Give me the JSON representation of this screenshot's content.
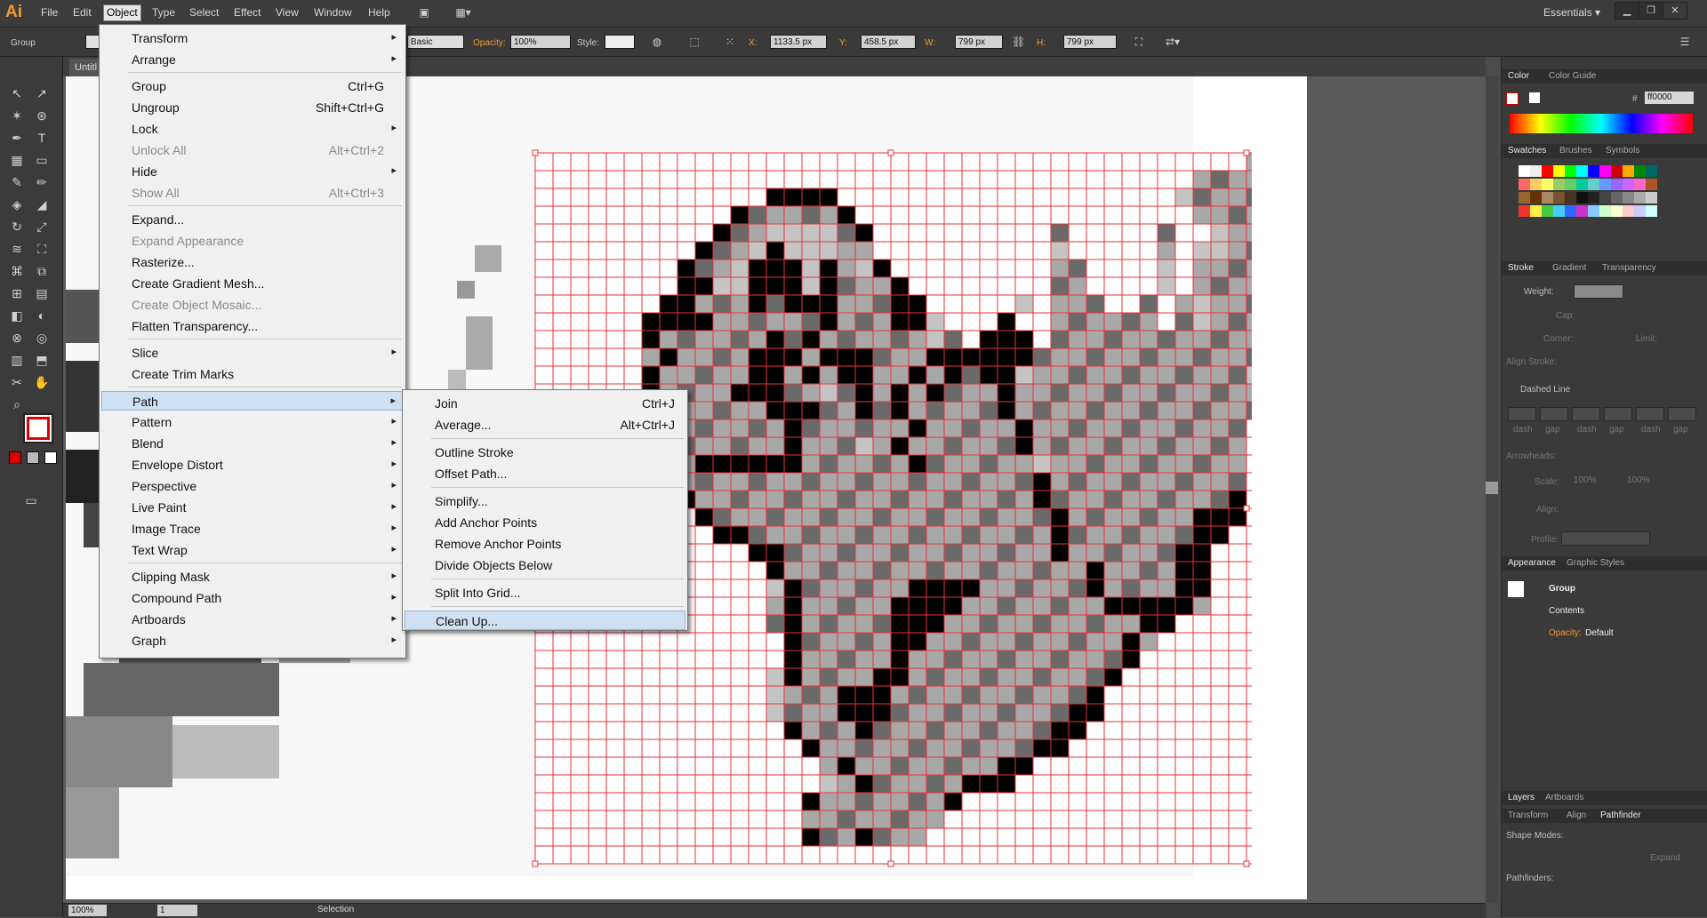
{
  "app": {
    "logo": "Ai"
  },
  "menubar": {
    "items": [
      "File",
      "Edit",
      "Object",
      "Type",
      "Select",
      "Effect",
      "View",
      "Window",
      "Help"
    ],
    "active": "Object",
    "workspace": "Essentials",
    "workspace_arrow": "▾"
  },
  "controlbar": {
    "selection": "Group",
    "stroke_style": "Basic",
    "opacity_label": "Opacity:",
    "opacity_value": "100%",
    "style_label": "Style:",
    "x_label": "X:",
    "x_value": "1133.5 px",
    "y_label": "Y:",
    "y_value": "458.5 px",
    "w_label": "W:",
    "w_value": "799 px",
    "h_label": "H:",
    "h_value": "799 px"
  },
  "document": {
    "tab_title": "Untitl"
  },
  "object_menu": {
    "items": [
      {
        "label": "Transform",
        "shortcut": "",
        "submenu": true,
        "disabled": false
      },
      {
        "label": "Arrange",
        "shortcut": "",
        "submenu": true,
        "disabled": false
      },
      {
        "sep": true
      },
      {
        "label": "Group",
        "shortcut": "Ctrl+G",
        "submenu": false,
        "disabled": false
      },
      {
        "label": "Ungroup",
        "shortcut": "Shift+Ctrl+G",
        "submenu": false,
        "disabled": false
      },
      {
        "label": "Lock",
        "shortcut": "",
        "submenu": true,
        "disabled": false
      },
      {
        "label": "Unlock All",
        "shortcut": "Alt+Ctrl+2",
        "submenu": false,
        "disabled": true
      },
      {
        "label": "Hide",
        "shortcut": "",
        "submenu": true,
        "disabled": false
      },
      {
        "label": "Show All",
        "shortcut": "Alt+Ctrl+3",
        "submenu": false,
        "disabled": true
      },
      {
        "sep": true
      },
      {
        "label": "Expand...",
        "shortcut": "",
        "submenu": false,
        "disabled": false
      },
      {
        "label": "Expand Appearance",
        "shortcut": "",
        "submenu": false,
        "disabled": true
      },
      {
        "label": "Rasterize...",
        "shortcut": "",
        "submenu": false,
        "disabled": false
      },
      {
        "label": "Create Gradient Mesh...",
        "shortcut": "",
        "submenu": false,
        "disabled": false
      },
      {
        "label": "Create Object Mosaic...",
        "shortcut": "",
        "submenu": false,
        "disabled": true
      },
      {
        "label": "Flatten Transparency...",
        "shortcut": "",
        "submenu": false,
        "disabled": false
      },
      {
        "sep": true
      },
      {
        "label": "Slice",
        "shortcut": "",
        "submenu": true,
        "disabled": false
      },
      {
        "label": "Create Trim Marks",
        "shortcut": "",
        "submenu": false,
        "disabled": false
      },
      {
        "sep": true
      },
      {
        "label": "Path",
        "shortcut": "",
        "submenu": true,
        "disabled": false,
        "highlight": true
      },
      {
        "label": "Pattern",
        "shortcut": "",
        "submenu": true,
        "disabled": false
      },
      {
        "label": "Blend",
        "shortcut": "",
        "submenu": true,
        "disabled": false
      },
      {
        "label": "Envelope Distort",
        "shortcut": "",
        "submenu": true,
        "disabled": false
      },
      {
        "label": "Perspective",
        "shortcut": "",
        "submenu": true,
        "disabled": false
      },
      {
        "label": "Live Paint",
        "shortcut": "",
        "submenu": true,
        "disabled": false
      },
      {
        "label": "Image Trace",
        "shortcut": "",
        "submenu": true,
        "disabled": false
      },
      {
        "label": "Text Wrap",
        "shortcut": "",
        "submenu": true,
        "disabled": false
      },
      {
        "sep": true
      },
      {
        "label": "Clipping Mask",
        "shortcut": "",
        "submenu": true,
        "disabled": false
      },
      {
        "label": "Compound Path",
        "shortcut": "",
        "submenu": true,
        "disabled": false
      },
      {
        "label": "Artboards",
        "shortcut": "",
        "submenu": true,
        "disabled": false
      },
      {
        "label": "Graph",
        "shortcut": "",
        "submenu": true,
        "disabled": false
      }
    ]
  },
  "path_menu": {
    "items": [
      {
        "label": "Join",
        "shortcut": "Ctrl+J"
      },
      {
        "label": "Average...",
        "shortcut": "Alt+Ctrl+J"
      },
      {
        "sep": true
      },
      {
        "label": "Outline Stroke",
        "shortcut": ""
      },
      {
        "label": "Offset Path...",
        "shortcut": ""
      },
      {
        "sep": true
      },
      {
        "label": "Simplify...",
        "shortcut": ""
      },
      {
        "label": "Add Anchor Points",
        "shortcut": ""
      },
      {
        "label": "Remove Anchor Points",
        "shortcut": ""
      },
      {
        "label": "Divide Objects Below",
        "shortcut": ""
      },
      {
        "sep": true
      },
      {
        "label": "Split Into Grid...",
        "shortcut": ""
      },
      {
        "sep": true
      },
      {
        "label": "Clean Up...",
        "shortcut": "",
        "highlight": true
      }
    ]
  },
  "panels": {
    "color": {
      "tabs": [
        "Color",
        "Color Guide"
      ],
      "hex_label": "#",
      "hex": "ff0000"
    },
    "swatches": {
      "tabs": [
        "Swatches",
        "Brushes",
        "Symbols"
      ]
    },
    "stroke": {
      "tabs": [
        "Stroke",
        "Gradient",
        "Transparency"
      ],
      "weight_label": "Weight:",
      "cap_label": "Cap:",
      "corner_label": "Corner:",
      "limit_label": "Limit:",
      "align_label": "Align Stroke:",
      "dashed_label": "Dashed Line",
      "dash_labels": [
        "dash",
        "gap",
        "dash",
        "gap",
        "dash",
        "gap"
      ],
      "arrowheads_label": "Arrowheads:",
      "scale_label": "Scale:",
      "scale1": "100%",
      "scale2": "100%",
      "align2_label": "Align:",
      "profile_label": "Profile:"
    },
    "appearance": {
      "tabs": [
        "Appearance",
        "Graphic Styles"
      ],
      "group": "Group",
      "contents": "Contents",
      "opacity_label": "Opacity:",
      "opacity_value": "Default"
    },
    "layers": {
      "tabs": [
        "Layers",
        "Artboards"
      ]
    },
    "pathfinder": {
      "tabs": [
        "Transform",
        "Align",
        "Pathfinder"
      ],
      "shape_modes": "Shape Modes:",
      "expand": "Expand",
      "pathfinders": "Pathfinders:"
    }
  },
  "status": {
    "zoom": "100%",
    "artboard": "1",
    "mode": "Selection"
  },
  "colors": {
    "grid_red": "#e8323a",
    "accent_orange": "#f29b2e",
    "menu_highlight": "#cfe0f3"
  },
  "pixel_art": {
    "rows": [
      "00000000000000000000000000000000000000002",
      "00000000000000000000000000000000000002222",
      "00000000000003333000000000000000000012222",
      "00000000000322222300000000000000000002222",
      "00000000003221111230000000000200000200122",
      "00000000032213111220000000000100000201122",
      "00000000322133313213000000000220000102222",
      "00000000331133313222300000000220000102222",
      "00000003322232333222330000010222002021222",
      "00000033332222223222331000300222222021222",
      "00000032222223232222221203330222222222222",
      "00000023222233323332223333332222222222222",
      "00000032222233232332232323312222222222221",
      "00000032222333221232323222322222222222222",
      "00000002222223332232322222322222222222222",
      "00000002222222322222232222232222222222220",
      "00000002222222322212322222232222222222220",
      "00000002233333322222232222221222222222220",
      "00000001222222222222222222223222222222220",
      "00000000322222222222222222223222222222230",
      "00000000032222222222222222222322222223330",
      "00000000003322222222222222222322222223300",
      "00000000000033222222222222222322222233000",
      "00000000000003222222222222222223222233000",
      "00000000000001322222233332222223222233000",
      "00000000000002322222333322222222333332000",
      "00000000000002322222333222222222223300000",
      "00000000000000322222332222222222232000000",
      "00000000000000322222322222222222230000000",
      "00000000000001322223322222222222300000000",
      "00000000000001222333222222222223000000000",
      "00000000000001222333222222222233000000000",
      "00000000000000322232222222222330000000000",
      "00000000000000032222222222223300000000000",
      "00000000000000002322222222330000000000000",
      "00000000000000001232222233300000000000000",
      "00000000000000032222222300000000000000000",
      "00000000000000022222222000000000000000000",
      "00000000000000032232220000000000000000000",
      "00000000000000000000000000000000000000000"
    ]
  }
}
